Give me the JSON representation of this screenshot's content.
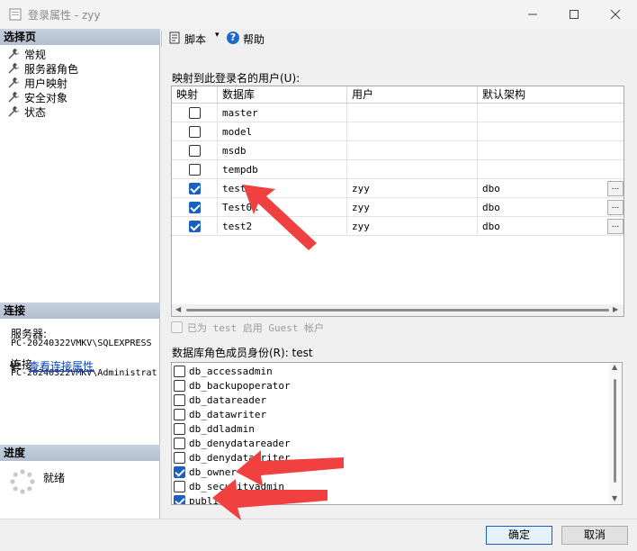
{
  "window": {
    "title": "登录属性 - zyy",
    "minimize_icon": "minimize-icon",
    "maximize_icon": "maximize-icon",
    "close_icon": "close-icon"
  },
  "left_panel": {
    "select_page_header": "选择页",
    "pages": [
      {
        "label": "常规",
        "icon": "wrench-icon"
      },
      {
        "label": "服务器角色",
        "icon": "wrench-icon"
      },
      {
        "label": "用户映射",
        "icon": "wrench-icon"
      },
      {
        "label": "安全对象",
        "icon": "wrench-icon"
      },
      {
        "label": "状态",
        "icon": "wrench-icon"
      }
    ],
    "connection_header": "连接",
    "server_label": "服务器:",
    "server_value": "PC-20240322VMKV\\SQLEXPRESS",
    "connection_label": "连接:",
    "connection_value": "PC-20240322VMKV\\Administrat",
    "view_connection_link": "查看连接属性",
    "progress_header": "进度",
    "progress_status": "就绪"
  },
  "toolbar": {
    "script_label": "脚本",
    "dropdown_glyph": "▾",
    "help_label": "帮助",
    "help_glyph": "?"
  },
  "user_mapping": {
    "section_label": "映射到此登录名的用户(U):",
    "columns": [
      "映射",
      "数据库",
      "用户",
      "默认架构"
    ],
    "rows": [
      {
        "mapped": false,
        "database": "master",
        "user": "",
        "schema": "",
        "has_button": false
      },
      {
        "mapped": false,
        "database": "model",
        "user": "",
        "schema": "",
        "has_button": false
      },
      {
        "mapped": false,
        "database": "msdb",
        "user": "",
        "schema": "",
        "has_button": false
      },
      {
        "mapped": false,
        "database": "tempdb",
        "user": "",
        "schema": "",
        "has_button": false
      },
      {
        "mapped": true,
        "database": "test",
        "user": "zyy",
        "schema": "dbo",
        "has_button": true
      },
      {
        "mapped": true,
        "database": "Test0…",
        "user": "zyy",
        "schema": "dbo",
        "has_button": true
      },
      {
        "mapped": true,
        "database": "test2",
        "user": "zyy",
        "schema": "dbo",
        "has_button": true
      }
    ],
    "ellipsis_label": "..."
  },
  "guest": {
    "checked": false,
    "label": "已为 test 启用 Guest 帐户"
  },
  "roles": {
    "section_label": "数据库角色成员身份(R): test",
    "items": [
      {
        "name": "db_accessadmin",
        "checked": false
      },
      {
        "name": "db_backupoperator",
        "checked": false
      },
      {
        "name": "db_datareader",
        "checked": false
      },
      {
        "name": "db_datawriter",
        "checked": false
      },
      {
        "name": "db_ddladmin",
        "checked": false
      },
      {
        "name": "db_denydatareader",
        "checked": false
      },
      {
        "name": "db_denydatawriter",
        "checked": false
      },
      {
        "name": "db_owner",
        "checked": true
      },
      {
        "name": "db_securityadmin",
        "checked": false
      },
      {
        "name": "public",
        "checked": true
      }
    ]
  },
  "buttons": {
    "ok": "确定",
    "cancel": "取消"
  },
  "colors": {
    "accent": "#1a5fc2",
    "annotation_arrow": "#f04040",
    "section_header": "#bcc7d6"
  }
}
